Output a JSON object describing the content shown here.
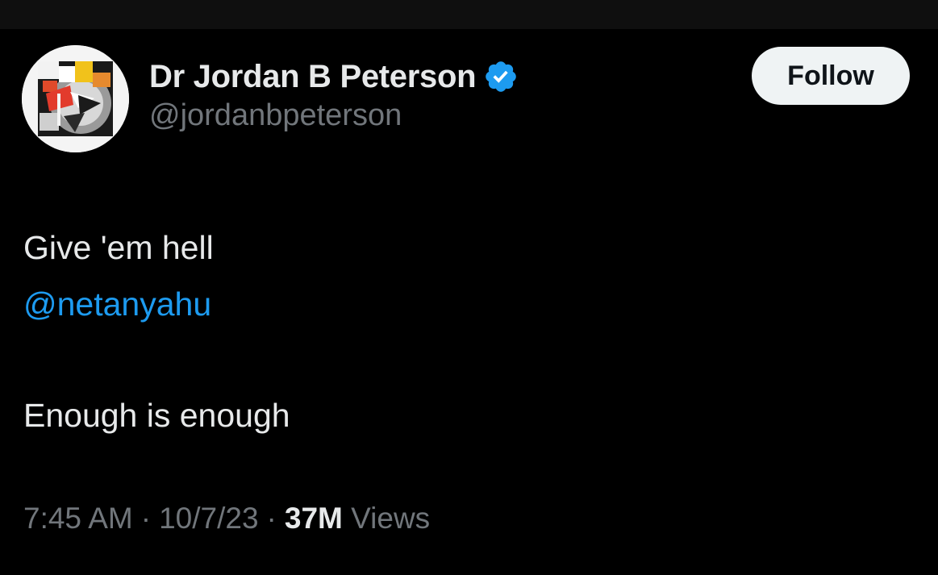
{
  "author": {
    "name": "Dr Jordan B Peterson",
    "handle": "@jordanbpeterson",
    "verified_color": "#1d9bf0"
  },
  "follow_button": {
    "label": "Follow"
  },
  "tweet": {
    "line1": "Give 'em hell",
    "mention": "@netanyahu",
    "line3": "Enough is enough"
  },
  "meta": {
    "time": "7:45 AM",
    "separator": "·",
    "date": "10/7/23",
    "views_count": "37M",
    "views_label": "Views"
  },
  "colors": {
    "background": "#000000",
    "text": "#e7e9ea",
    "secondary": "#71767b",
    "link": "#1d9bf0"
  }
}
